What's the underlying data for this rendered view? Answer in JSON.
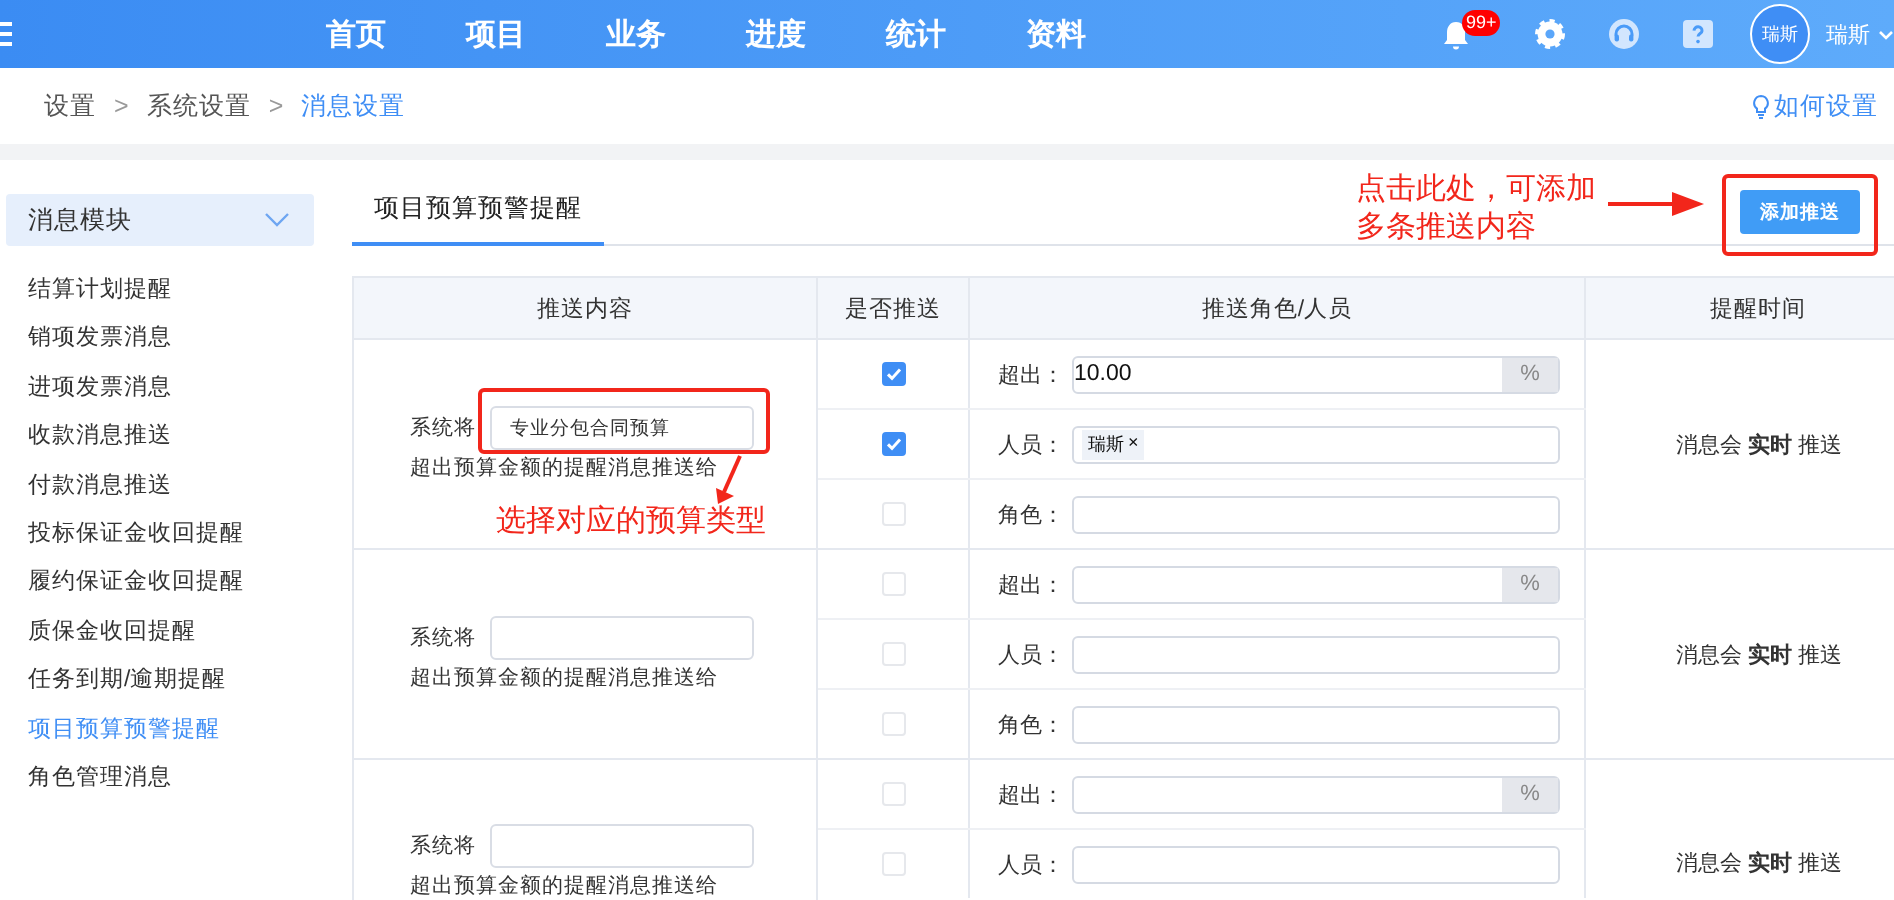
{
  "topbar": {
    "nav": [
      "首页",
      "项目",
      "业务",
      "进度",
      "统计",
      "资料"
    ],
    "badge": "99+",
    "avatar_text": "瑞斯",
    "user_name": "瑞斯"
  },
  "breadcrumb": {
    "separator": ">",
    "items": [
      {
        "label": "设置",
        "current": false
      },
      {
        "label": "系统设置",
        "current": false
      },
      {
        "label": "消息设置",
        "current": true
      }
    ],
    "help_link": "如何设置"
  },
  "sidebar": {
    "title": "消息模块",
    "items": [
      {
        "label": "结算计划提醒",
        "selected": false
      },
      {
        "label": "销项发票消息",
        "selected": false
      },
      {
        "label": "进项发票消息",
        "selected": false
      },
      {
        "label": "收款消息推送",
        "selected": false
      },
      {
        "label": "付款消息推送",
        "selected": false
      },
      {
        "label": "投标保证金收回提醒",
        "selected": false
      },
      {
        "label": "履约保证金收回提醒",
        "selected": false
      },
      {
        "label": "质保金收回提醒",
        "selected": false
      },
      {
        "label": "任务到期/逾期提醒",
        "selected": false
      },
      {
        "label": "项目预算预警提醒",
        "selected": true
      },
      {
        "label": "角色管理消息",
        "selected": false
      }
    ]
  },
  "tabs": [
    {
      "label": "项目预算预警提醒",
      "selected": true
    }
  ],
  "add_button": "添加推送",
  "table": {
    "columns": [
      "推送内容",
      "是否推送",
      "推送角色/人员",
      "提醒时间"
    ],
    "groups": [
      {
        "prefix": "系统将",
        "budget_type": "专业分包合同预算",
        "suffix": "超出预算金额的提醒消息推送给",
        "timing": "消息会 **实时** 推送",
        "rows": [
          {
            "kind": "percent",
            "label": "超出：",
            "value": "10.00",
            "unit": "%",
            "checked": true
          },
          {
            "kind": "people",
            "label": "人员：",
            "tags": [
              {
                "label": "瑞斯",
                "remove": "×"
              }
            ],
            "checked": true
          },
          {
            "kind": "text",
            "label": "角色：",
            "checked": false
          }
        ]
      },
      {
        "prefix": "系统将",
        "suffix": "超出预算金额的提醒消息推送给",
        "timing": "消息会 **实时** 推送",
        "rows": [
          {
            "kind": "percent",
            "label": "超出：",
            "unit": "%",
            "checked": false
          },
          {
            "kind": "people",
            "label": "人员：",
            "checked": false
          },
          {
            "kind": "text",
            "label": "角色：",
            "checked": false
          }
        ]
      },
      {
        "prefix": "系统将",
        "suffix": "超出预算金额的提醒消息推送给",
        "timing": "消息会 **实时** 推送",
        "rows": [
          {
            "kind": "percent",
            "label": "超出：",
            "unit": "%",
            "checked": false
          },
          {
            "kind": "people",
            "label": "人员：",
            "checked": false
          }
        ]
      }
    ]
  },
  "annotations": [
    {
      "kind": "select",
      "lines": [
        "选择对应的预算类型"
      ]
    },
    {
      "kind": "add",
      "lines": [
        "点击此处，可添加",
        "多条推送内容"
      ]
    }
  ]
}
